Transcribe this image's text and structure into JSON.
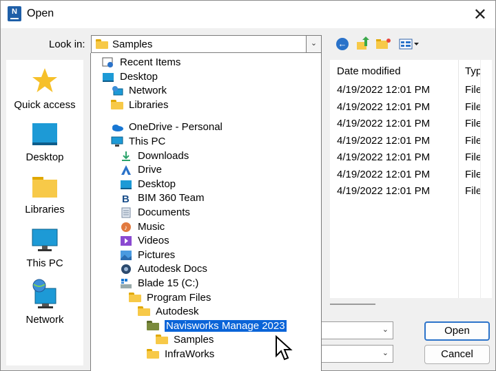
{
  "window": {
    "title": "Open",
    "app_icon_letter": "N"
  },
  "look_in": {
    "label": "Look in:",
    "value": "Samples"
  },
  "toolbar": {
    "icons": [
      "back-arrow-icon",
      "up-folder-icon",
      "new-folder-icon",
      "view-menu-icon"
    ]
  },
  "places": [
    {
      "label": "Quick access",
      "icon": "star-icon"
    },
    {
      "label": "Desktop",
      "icon": "desktop-icon"
    },
    {
      "label": "Libraries",
      "icon": "libraries-folder-icon"
    },
    {
      "label": "This PC",
      "icon": "monitor-icon"
    },
    {
      "label": "Network",
      "icon": "network-icon"
    }
  ],
  "file_list": {
    "columns": [
      "Date modified",
      "Type"
    ],
    "rows": [
      {
        "date": "4/19/2022 12:01 PM",
        "type": "File fo"
      },
      {
        "date": "4/19/2022 12:01 PM",
        "type": "File fo"
      },
      {
        "date": "4/19/2022 12:01 PM",
        "type": "File fo"
      },
      {
        "date": "4/19/2022 12:01 PM",
        "type": "File fo"
      },
      {
        "date": "4/19/2022 12:01 PM",
        "type": "File fo"
      },
      {
        "date": "4/19/2022 12:01 PM",
        "type": "File fo"
      },
      {
        "date": "4/19/2022 12:01 PM",
        "type": "File fo"
      }
    ]
  },
  "dropdown": {
    "items": [
      {
        "label": "Recent Items",
        "icon": "recent-items-icon"
      },
      {
        "label": "Desktop",
        "icon": "desktop-icon"
      },
      {
        "label": "Network",
        "icon": "network-icon"
      },
      {
        "label": "Libraries",
        "icon": "folder-icon"
      },
      {
        "label": "OneDrive - Personal",
        "icon": "onedrive-cloud-icon"
      },
      {
        "label": "This PC",
        "icon": "monitor-icon"
      },
      {
        "label": "Downloads",
        "icon": "download-arrow-icon"
      },
      {
        "label": "Drive",
        "icon": "drive-icon"
      },
      {
        "label": "Desktop",
        "icon": "desktop-icon"
      },
      {
        "label": "BIM 360 Team",
        "icon": "bim360-icon"
      },
      {
        "label": "Documents",
        "icon": "documents-icon"
      },
      {
        "label": "Music",
        "icon": "music-icon"
      },
      {
        "label": "Videos",
        "icon": "videos-icon"
      },
      {
        "label": "Pictures",
        "icon": "pictures-icon"
      },
      {
        "label": "Autodesk Docs",
        "icon": "autodesk-docs-icon"
      },
      {
        "label": "Blade 15 (C:)",
        "icon": "windows-drive-icon"
      },
      {
        "label": "Program Files",
        "icon": "folder-icon"
      },
      {
        "label": "Autodesk",
        "icon": "folder-icon"
      },
      {
        "label": "Navisworks Manage 2023",
        "icon": "folder-open-icon",
        "selected": true
      },
      {
        "label": "Samples",
        "icon": "folder-icon"
      },
      {
        "label": "InfraWorks",
        "icon": "folder-icon"
      }
    ]
  },
  "buttons": {
    "open": "Open",
    "cancel": "Cancel"
  },
  "colors": {
    "selection": "#0a64d8",
    "accent": "#2a72c9",
    "folder": "#f7c948"
  }
}
